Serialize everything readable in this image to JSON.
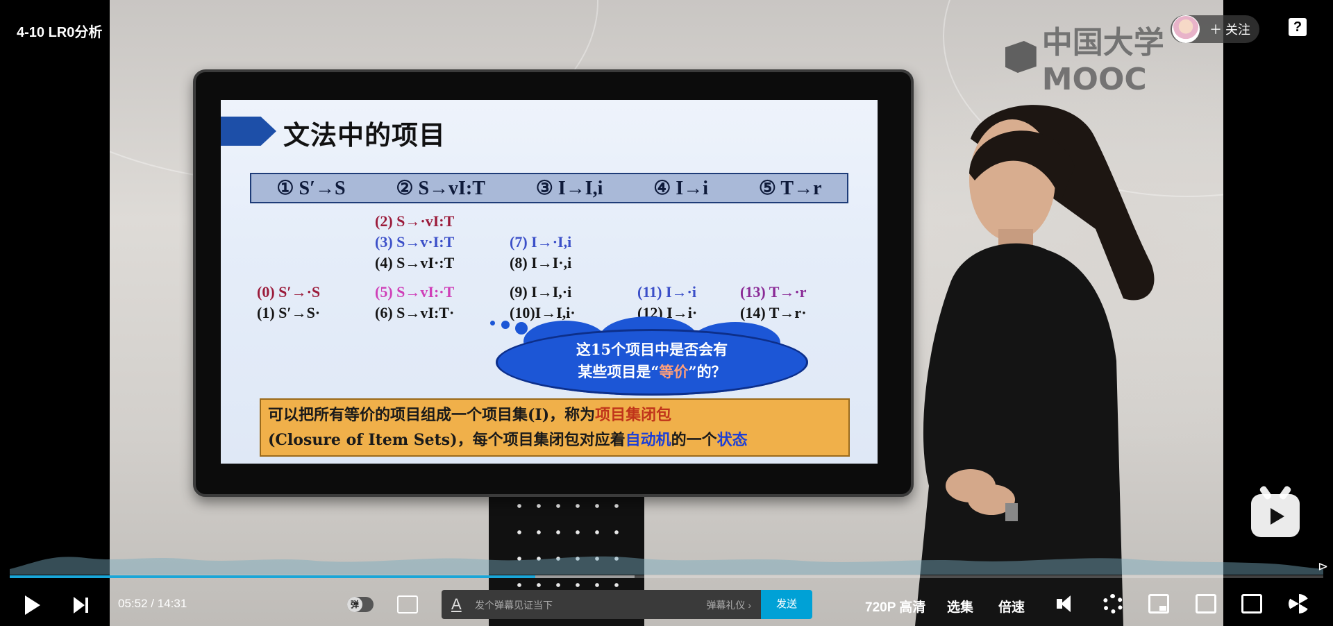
{
  "video": {
    "title": "4-10 LR0分析",
    "logo_text": "中国大学MOOC",
    "follow_label": "＋ 关注",
    "help_label": "?",
    "slide": {
      "title": "文法中的项目",
      "rules": [
        "① S′→S",
        "② S→vI:T",
        "③ I→I,i",
        "④ I→i",
        "⑤ T→r"
      ],
      "items": {
        "i0": "(0) S′→·S",
        "i1": "(1) S′→S·",
        "i2": "(2) S→·vI:T",
        "i3": "(3) S→v·I:T",
        "i4": "(4) S→vI·:T",
        "i5": "(5) S→vI:·T",
        "i6": "(6) S→vI:T·",
        "i7": "(7)  I→·I,i",
        "i8": "(8)  I→I·,i",
        "i9": "(9)  I→I,·i",
        "i10": "(10)I→I,i·",
        "i11": "(11) I→·i",
        "i12": "(12) I→i·",
        "i13": "(13) T→·r",
        "i14": "(14) T→r·"
      },
      "cloud": {
        "line1": "这15个项目中是否会有",
        "line2_a": "某些项目是“",
        "line2_hl": "等价",
        "line2_b": "”的？"
      },
      "note": {
        "p1": "可以把所有等价的项目组成一个项目集(I)，称为",
        "p1_kw": "项目集闭包",
        "p2": "(Closure of Item Sets)，每个项目集闭包对应着",
        "p2_kw1": "自动机",
        "p2_mid": "的一个",
        "p2_kw2": "状态"
      }
    }
  },
  "controls": {
    "time_current": "05:52",
    "time_sep": "/",
    "time_total": "14:31",
    "progress": 0.4,
    "danmu_toggle_label": "弹",
    "danmu_placeholder": "发个弹幕见证当下",
    "danmu_etiquette": "弹幕礼仪 ›",
    "send_label": "发送",
    "quality": "720P 高清",
    "episodes": "选集",
    "speed": "倍速"
  },
  "colors": {
    "accent": "#00a1d6",
    "progress": "#1aa6d8"
  }
}
